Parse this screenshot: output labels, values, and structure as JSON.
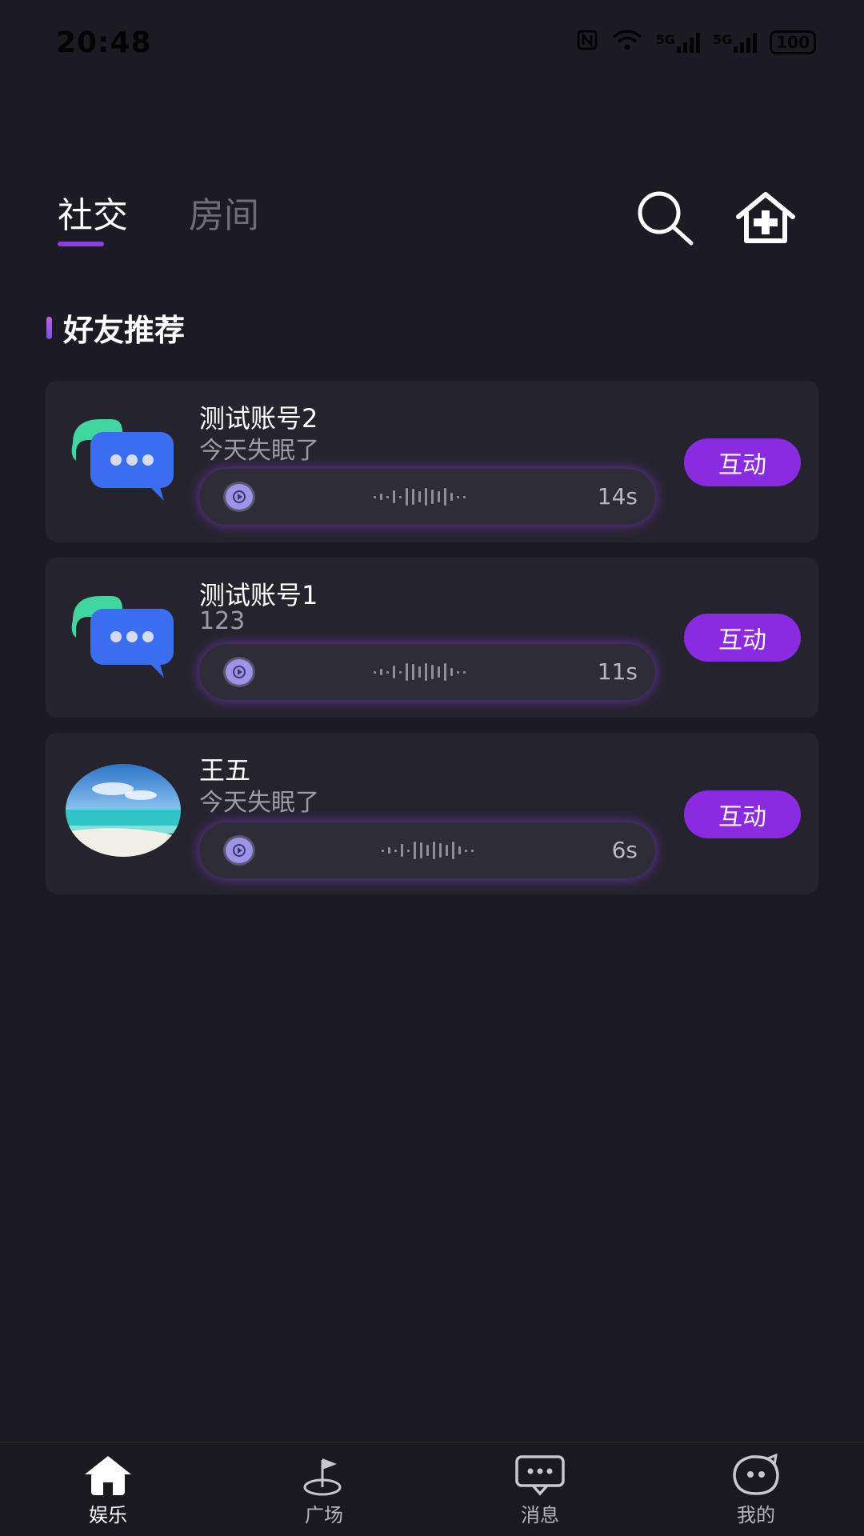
{
  "status_bar": {
    "time": "20:48",
    "network_1": "5G",
    "network_2": "5G",
    "battery": "100"
  },
  "header": {
    "tabs": [
      {
        "label": "社交",
        "active": true
      },
      {
        "label": "房间",
        "active": false
      }
    ],
    "search_icon": "search-icon",
    "add_room_icon": "home-plus-icon"
  },
  "section": {
    "title": "好友推荐"
  },
  "friends": [
    {
      "name": "测试账号2",
      "subtitle": "今天失眠了",
      "duration": "14s",
      "action": "互动",
      "avatar": "chat-bubble-avatar"
    },
    {
      "name": "测试账号1",
      "subtitle": "123",
      "duration": "11s",
      "action": "互动",
      "avatar": "chat-bubble-avatar"
    },
    {
      "name": "王五",
      "subtitle": "今天失眠了",
      "duration": "6s",
      "action": "互动",
      "avatar": "beach-photo-avatar"
    }
  ],
  "bottom_nav": {
    "items": [
      {
        "label": "娱乐",
        "icon": "home-icon",
        "active": true
      },
      {
        "label": "广场",
        "icon": "flag-icon",
        "active": false
      },
      {
        "label": "消息",
        "icon": "message-icon",
        "active": false
      },
      {
        "label": "我的",
        "icon": "face-icon",
        "active": false
      }
    ]
  },
  "colors": {
    "accent": "#8a2be2",
    "background": "#1c1b24",
    "card": "#25242d"
  }
}
